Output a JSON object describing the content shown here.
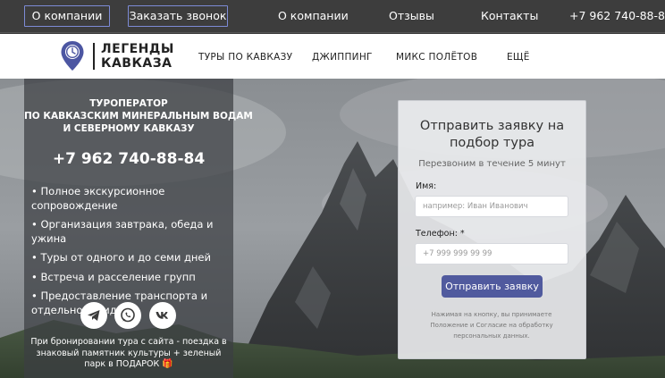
{
  "topbar": {
    "about_button": "О компании",
    "callback_button": "Заказать звонок",
    "links": [
      "О компании",
      "Отзывы",
      "Контакты"
    ],
    "phone": "+7 962 740-88-84"
  },
  "logo": {
    "line1": "ЛЕГЕНДЫ",
    "line2": "КАВКАЗА"
  },
  "nav": {
    "items": [
      "ТУРЫ ПО КАВКАЗУ",
      "ДЖИППИНГ",
      "МИКС ПОЛЁТОВ",
      "ЕЩЁ"
    ]
  },
  "info": {
    "heading": [
      "ТУРОПЕРАТОР",
      "ПО КАВКАЗСКИМ МИНЕРАЛЬНЫМ ВОДАМ",
      "И СЕВЕРНОМУ КАВКАЗУ"
    ],
    "phone": "+7 962 740-88-84",
    "features": [
      "• Полное экскурсионное сопровождение",
      "• Организация завтрака, обеда и ужина",
      "• Туры от одного и до семи дней",
      "• Встреча и расселение групп",
      "• Предоставление транспорта и отдельного гида"
    ],
    "promo": "При бронировании тура с сайта - поездка в знаковый памятник культуры + зеленый парк в ПОДАРОК",
    "gift_icon": "🎁"
  },
  "social": {
    "icons": [
      "telegram-icon",
      "whatsapp-icon",
      "vk-icon"
    ]
  },
  "form": {
    "title": "Отправить заявку на подбор тура",
    "subtitle": "Перезвоним в течение 5 минут",
    "name_label": "Имя:",
    "name_placeholder": "например: Иван Иванович",
    "phone_label": "Телефон: *",
    "phone_placeholder": "+7 999 999 99 99",
    "submit": "Отправить заявку",
    "consent": "Нажимая на кнопку, вы принимаете Положение и Согласие на обработку персональных данных."
  },
  "colors": {
    "accent": "#505a9e",
    "topbar": "#3d3d3d",
    "button_border": "#7d8bd6"
  }
}
